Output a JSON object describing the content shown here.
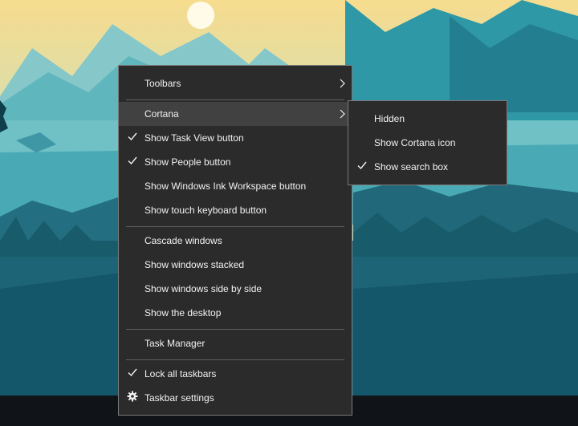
{
  "colors": {
    "menu_bg": "#2b2b2b",
    "menu_border": "#7a7a7a",
    "highlight": "#414141",
    "text": "#f2f2f2",
    "separator": "#5e5e5e",
    "taskbar": "#101418"
  },
  "context_menu": {
    "items": [
      {
        "label": "Toolbars",
        "submenu": true
      },
      {
        "label": "Cortana",
        "submenu": true,
        "highlighted": true
      },
      {
        "label": "Show Task View button",
        "checked": true
      },
      {
        "label": "Show People button",
        "checked": true
      },
      {
        "label": "Show Windows Ink Workspace button"
      },
      {
        "label": "Show touch keyboard button"
      },
      {
        "label": "Cascade windows"
      },
      {
        "label": "Show windows stacked"
      },
      {
        "label": "Show windows side by side"
      },
      {
        "label": "Show the desktop"
      },
      {
        "label": "Task Manager"
      },
      {
        "label": "Lock all taskbars",
        "checked": true
      },
      {
        "label": "Taskbar settings",
        "icon": "gear-icon"
      }
    ]
  },
  "cortana_submenu": {
    "items": [
      {
        "label": "Hidden"
      },
      {
        "label": "Show Cortana icon"
      },
      {
        "label": "Show search box",
        "checked": true
      }
    ]
  }
}
